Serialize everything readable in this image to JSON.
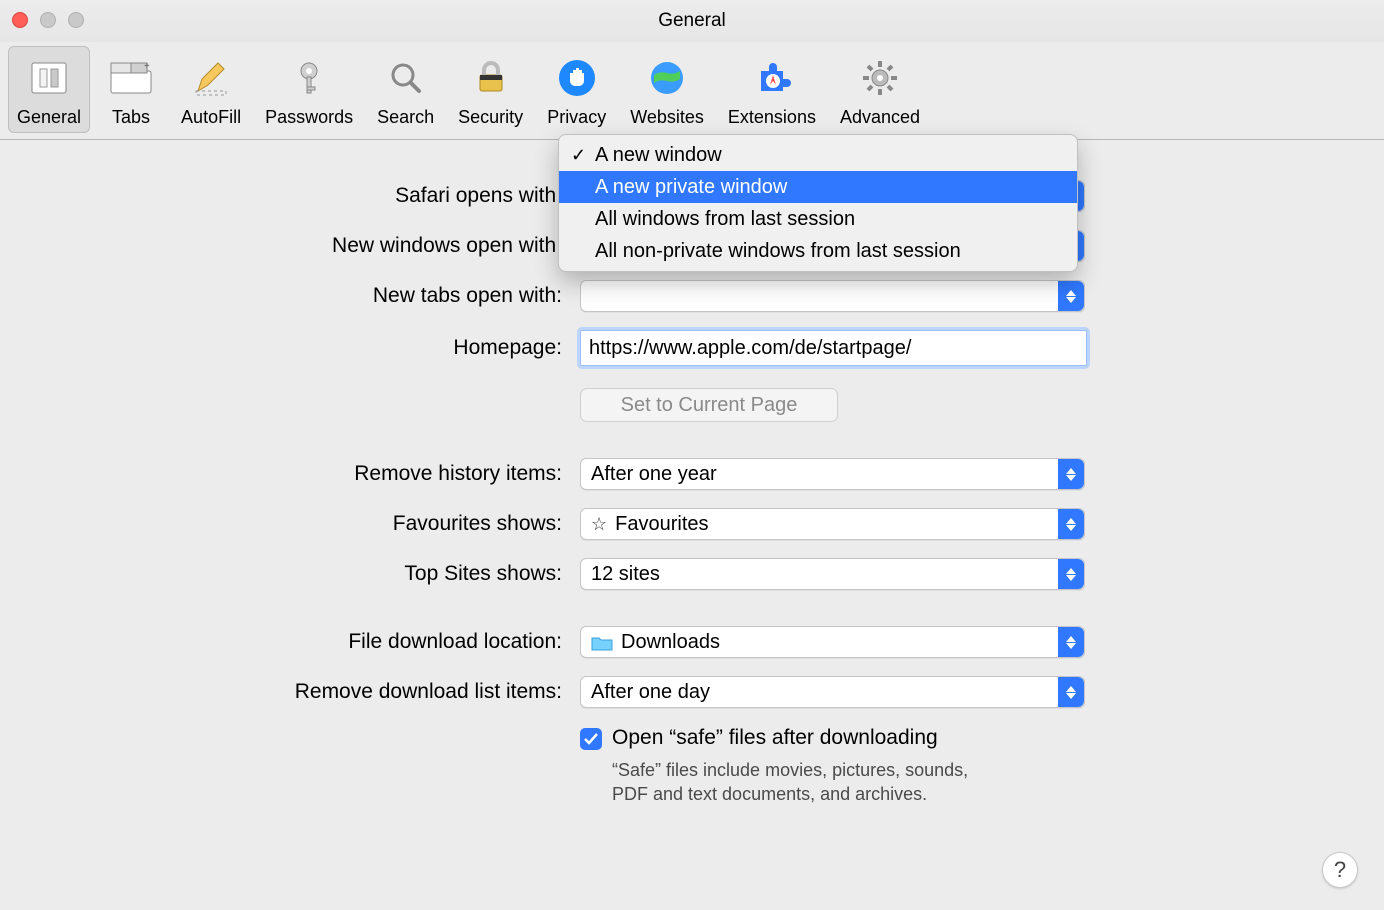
{
  "window": {
    "title": "General"
  },
  "toolbar": {
    "items": [
      {
        "label": "General",
        "icon": "switch",
        "selected": true
      },
      {
        "label": "Tabs",
        "icon": "tabs",
        "selected": false
      },
      {
        "label": "AutoFill",
        "icon": "pencil",
        "selected": false
      },
      {
        "label": "Passwords",
        "icon": "key",
        "selected": false
      },
      {
        "label": "Search",
        "icon": "magnifier",
        "selected": false
      },
      {
        "label": "Security",
        "icon": "lock",
        "selected": false
      },
      {
        "label": "Privacy",
        "icon": "hand",
        "selected": false
      },
      {
        "label": "Websites",
        "icon": "globe",
        "selected": false
      },
      {
        "label": "Extensions",
        "icon": "puzzle",
        "selected": false
      },
      {
        "label": "Advanced",
        "icon": "gear",
        "selected": false
      }
    ]
  },
  "form": {
    "safari_opens_label": "Safari opens with:",
    "new_windows_label": "New windows open with:",
    "new_tabs_label": "New tabs open with:",
    "homepage_label": "Homepage:",
    "homepage_value": "https://www.apple.com/de/startpage/",
    "set_current_label": "Set to Current Page",
    "remove_history_label": "Remove history items:",
    "remove_history_value": "After one year",
    "favourites_label": "Favourites shows:",
    "favourites_value": "Favourites",
    "topsites_label": "Top Sites shows:",
    "topsites_value": "12 sites",
    "download_loc_label": "File download location:",
    "download_loc_value": "Downloads",
    "remove_dl_label": "Remove download list items:",
    "remove_dl_value": "After one day",
    "open_safe_label": "Open “safe” files after downloading",
    "open_safe_desc": "“Safe” files include movies, pictures, sounds, PDF and text documents, and archives."
  },
  "dropdown": {
    "options": [
      "A new window",
      "A new private window",
      "All windows from last session",
      "All non-private windows from last session"
    ],
    "checked_index": 0,
    "highlight_index": 1
  },
  "help": {
    "label": "?"
  }
}
